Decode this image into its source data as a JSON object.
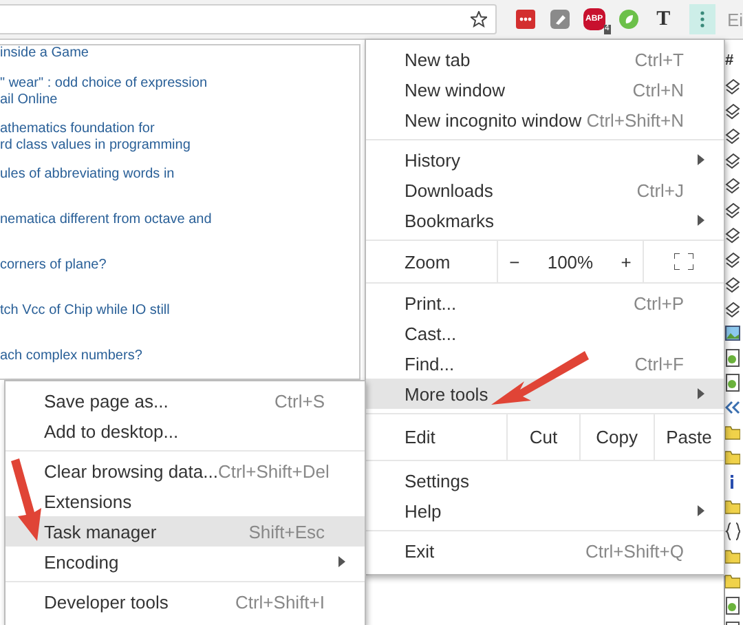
{
  "toolbar": {
    "extensions": [
      {
        "kind": "dots"
      },
      {
        "kind": "note"
      },
      {
        "kind": "abp",
        "label": "ABP",
        "badge": "4"
      },
      {
        "kind": "leaf"
      },
      {
        "kind": "letter",
        "label": "T"
      }
    ],
    "corner_text": "Ei"
  },
  "page_links": [
    {
      "lines": [
        "inside a Game"
      ]
    },
    {
      "lines": [
        "\" wear\" : odd choice of expression",
        "ail Online"
      ]
    },
    {
      "lines": [
        "athematics foundation for",
        "rd class values in programming"
      ]
    },
    {
      "lines": [
        "ules of abbreviating words in"
      ]
    },
    {
      "lines": [
        "nematica different from octave and"
      ]
    },
    {
      "lines": [
        "corners of plane?"
      ]
    },
    {
      "lines": [
        "tch Vcc of Chip while IO still"
      ]
    },
    {
      "lines": [
        "ach complex numbers?"
      ]
    }
  ],
  "side_panel": {
    "header": "#",
    "icons": [
      {
        "kind": "stack"
      },
      {
        "kind": "stack"
      },
      {
        "kind": "stack"
      },
      {
        "kind": "stack"
      },
      {
        "kind": "stack"
      },
      {
        "kind": "stack"
      },
      {
        "kind": "stack"
      },
      {
        "kind": "stack"
      },
      {
        "kind": "stack"
      },
      {
        "kind": "stack"
      },
      {
        "kind": "image"
      },
      {
        "kind": "doc"
      },
      {
        "kind": "doc"
      },
      {
        "kind": "chevrons"
      },
      {
        "kind": "folder"
      },
      {
        "kind": "folder"
      },
      {
        "kind": "info"
      },
      {
        "kind": "folder"
      },
      {
        "kind": "braces"
      },
      {
        "kind": "folder"
      },
      {
        "kind": "folder"
      },
      {
        "kind": "doc"
      },
      {
        "kind": "doc"
      }
    ]
  },
  "main_menu": {
    "groups": [
      [
        {
          "kind": "item",
          "label": "New tab",
          "shortcut": "Ctrl+T",
          "submenu": false,
          "selected": false
        },
        {
          "kind": "item",
          "label": "New window",
          "shortcut": "Ctrl+N",
          "submenu": false,
          "selected": false
        },
        {
          "kind": "item",
          "label": "New incognito window",
          "shortcut": "Ctrl+Shift+N",
          "submenu": false,
          "selected": false
        }
      ],
      [
        {
          "kind": "item",
          "label": "History",
          "submenu": true,
          "selected": false
        },
        {
          "kind": "item",
          "label": "Downloads",
          "shortcut": "Ctrl+J",
          "submenu": false,
          "selected": false
        },
        {
          "kind": "item",
          "label": "Bookmarks",
          "submenu": true,
          "selected": false
        }
      ],
      [
        {
          "kind": "zoom",
          "label": "Zoom",
          "minus": "−",
          "value": "100%",
          "plus": "+"
        }
      ],
      [
        {
          "kind": "item",
          "label": "Print...",
          "shortcut": "Ctrl+P",
          "submenu": false,
          "selected": false
        },
        {
          "kind": "item",
          "label": "Cast...",
          "submenu": false,
          "selected": false
        },
        {
          "kind": "item",
          "label": "Find...",
          "shortcut": "Ctrl+F",
          "submenu": false,
          "selected": false
        },
        {
          "kind": "item",
          "label": "More tools",
          "submenu": true,
          "selected": true
        }
      ],
      [
        {
          "kind": "edit",
          "label": "Edit",
          "buttons": [
            "Cut",
            "Copy",
            "Paste"
          ]
        }
      ],
      [
        {
          "kind": "item",
          "label": "Settings",
          "submenu": false,
          "selected": false
        },
        {
          "kind": "item",
          "label": "Help",
          "submenu": true,
          "selected": false
        }
      ],
      [
        {
          "kind": "item",
          "label": "Exit",
          "shortcut": "Ctrl+Shift+Q",
          "submenu": false,
          "selected": false
        }
      ]
    ]
  },
  "more_tools_menu": {
    "groups": [
      [
        {
          "kind": "item",
          "label": "Save page as...",
          "shortcut": "Ctrl+S",
          "submenu": false,
          "selected": false
        },
        {
          "kind": "item",
          "label": "Add to desktop...",
          "submenu": false,
          "selected": false
        }
      ],
      [
        {
          "kind": "item",
          "label": "Clear browsing data...",
          "shortcut": "Ctrl+Shift+Del",
          "submenu": false,
          "selected": false
        },
        {
          "kind": "item",
          "label": "Extensions",
          "submenu": false,
          "selected": false
        },
        {
          "kind": "item",
          "label": "Task manager",
          "shortcut": "Shift+Esc",
          "submenu": false,
          "selected": true
        },
        {
          "kind": "item",
          "label": "Encoding",
          "submenu": true,
          "selected": false
        }
      ],
      [
        {
          "kind": "item",
          "label": "Developer tools",
          "shortcut": "Ctrl+Shift+I",
          "submenu": false,
          "selected": false
        }
      ]
    ]
  },
  "annotations": [
    {
      "kind": "arrow"
    },
    {
      "kind": "arrow"
    }
  ]
}
